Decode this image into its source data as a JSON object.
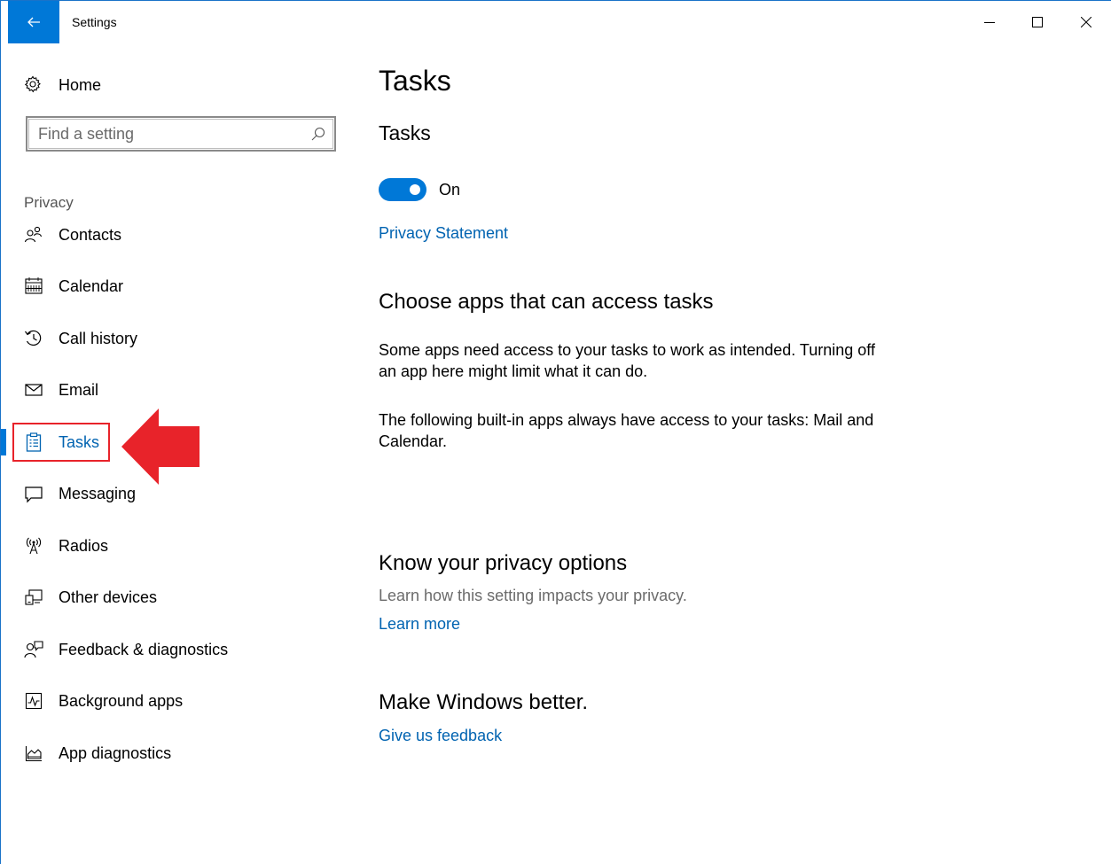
{
  "window": {
    "title": "Settings"
  },
  "sidebar": {
    "home_label": "Home",
    "search_placeholder": "Find a setting",
    "section_header": "Privacy",
    "items": [
      {
        "label": "Contacts",
        "icon": "contacts-icon"
      },
      {
        "label": "Calendar",
        "icon": "calendar-icon"
      },
      {
        "label": "Call history",
        "icon": "call-history-icon"
      },
      {
        "label": "Email",
        "icon": "email-icon"
      },
      {
        "label": "Tasks",
        "icon": "tasks-icon",
        "active": true
      },
      {
        "label": "Messaging",
        "icon": "messaging-icon"
      },
      {
        "label": "Radios",
        "icon": "radios-icon"
      },
      {
        "label": "Other devices",
        "icon": "other-devices-icon"
      },
      {
        "label": "Feedback & diagnostics",
        "icon": "feedback-icon"
      },
      {
        "label": "Background apps",
        "icon": "background-apps-icon"
      },
      {
        "label": "App diagnostics",
        "icon": "app-diagnostics-icon"
      }
    ]
  },
  "main": {
    "page_title": "Tasks",
    "sub_title": "Tasks",
    "toggle": {
      "state": "On",
      "on": true
    },
    "privacy_statement": "Privacy Statement",
    "choose_heading": "Choose apps that can access tasks",
    "choose_para1": "Some apps need access to your tasks to work as intended. Turning off an app here might limit what it can do.",
    "choose_para2": "The following built-in apps always have access to your tasks: Mail and Calendar.",
    "know_heading": "Know your privacy options",
    "know_desc": "Learn how this setting impacts your privacy.",
    "learn_more": "Learn more",
    "better_heading": "Make Windows better.",
    "feedback_link": "Give us feedback"
  },
  "colors": {
    "accent": "#0078d7",
    "link": "#0063b1",
    "annotation": "#e8232a"
  }
}
